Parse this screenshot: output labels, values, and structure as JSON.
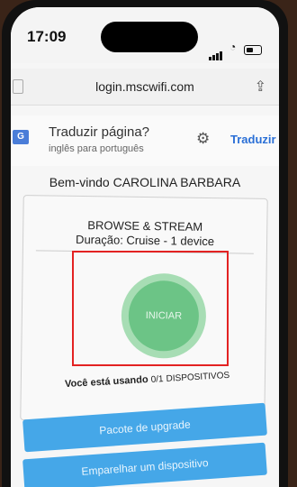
{
  "status_bar": {
    "time": "17:09"
  },
  "browser": {
    "url": "login.mscwifi.com"
  },
  "translate_bar": {
    "title": "Traduzir página?",
    "subtitle": "inglês para português",
    "button": "Traduzir",
    "icon": "G"
  },
  "page": {
    "welcome": "Bem-vindo CAROLINA BARBARA",
    "package_name": "BROWSE & STREAM",
    "duration": "Duração: Cruise - 1 device",
    "start_button": "INICIAR",
    "usage_prefix": "Você está usando",
    "usage_count": "0/1",
    "usage_suffix": "DISPOSITIVOS",
    "buttons": [
      "Pacote de upgrade",
      "Emparelhar um dispositivo"
    ]
  },
  "colors": {
    "start_circle": "#6cc486",
    "action_button": "#45a7e8",
    "highlight_box": "#e32222",
    "translate_link": "#2a6fd6"
  }
}
